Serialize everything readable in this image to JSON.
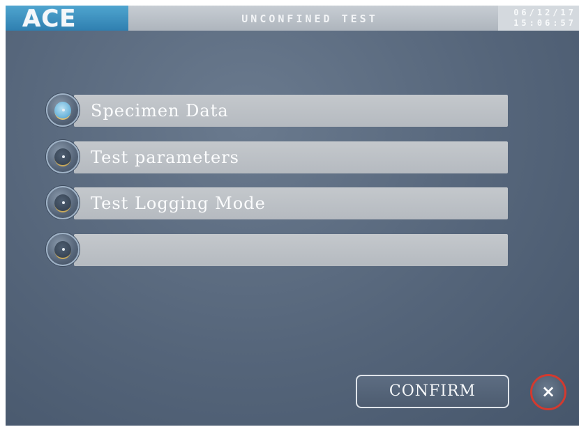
{
  "header": {
    "logo": "ACE",
    "title": "UNCONFINED TEST",
    "date": "06/12/17",
    "time": "15:06:57"
  },
  "menu": {
    "items": [
      {
        "label": "Specimen Data",
        "selected": true
      },
      {
        "label": "Test parameters",
        "selected": false
      },
      {
        "label": "Test Logging Mode",
        "selected": false
      },
      {
        "label": "",
        "selected": false
      }
    ]
  },
  "footer": {
    "confirm_label": "CONFIRM",
    "close_label": "×"
  },
  "colors": {
    "logo_bg": "#2f7fb0",
    "close_border": "#d33a2f",
    "screen_bg": "#55657a"
  }
}
